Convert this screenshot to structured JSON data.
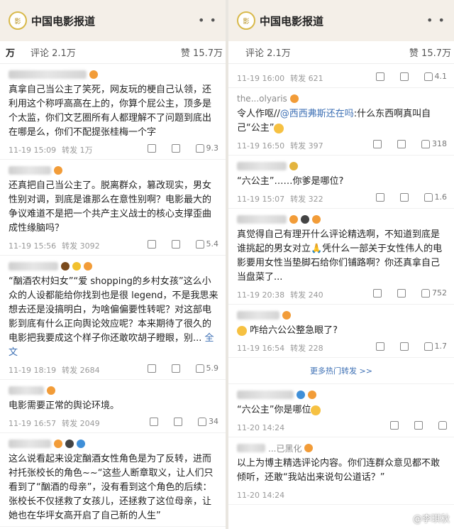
{
  "account": {
    "name": "中国电影报道",
    "more": "• •"
  },
  "left": {
    "stats": {
      "reposts": "万",
      "comments": "评论 2.1万",
      "likes": "赞 15.7万"
    },
    "comments": [
      {
        "user": "",
        "text": "真拿自己当公主了笑死，网友玩的梗自己认领，还利用这个称呼高高在上的，你算个屁公主，顶多是个太监，你们文艺圈所有人都理解不了问题到底出在哪是么，你们不配提张桂梅一个字",
        "time": "11-19 15:09",
        "repost": "转发 1万",
        "likes": "9.3"
      },
      {
        "user": "",
        "text": "还真把自己当公主了。脱离群众，篡改现实，男女性别对调，到底是谁那么在意性别啊？电影最大的争议难道不是把一个共产主义战士的核心支撑歪曲成性缘脑吗？",
        "time": "11-19 15:56",
        "repost": "转发 3092",
        "likes": "5.4"
      },
      {
        "user": "",
        "text": "“酗酒农村妇女”“爱 shopping的乡村女孩”这么小众的人设都能给你找到也是很 legend，不是我思来想去还是没搞明白，为啥偏偏要性转呢？对这部电影到底有什么正向舆论效应呢？本来期待了很久的电影把我要成这个样子你还敢吹胡子瞪眼，别...",
        "more": "全文",
        "time": "11-19 18:19",
        "repost": "转发 2684",
        "likes": "5.9"
      },
      {
        "user": "",
        "text": "电影需要正常的舆论环境。",
        "time": "11-19 16:57",
        "repost": "转发 2049",
        "likes": "34"
      },
      {
        "user": "",
        "text": "这么说看起来设定酗酒女性角色是为了反转，进而衬托张校长的角色~~“这些人断章取义，让人们只看到了“酗酒的母亲”，没有看到这个角色的后续：张校长不仅拯救了女孩儿，还拯救了这位母亲，让她也在华坪女高开启了自己新的人生”",
        "time": "",
        "repost": "",
        "likes": ""
      }
    ]
  },
  "right": {
    "stats": {
      "comments": "评论 2.1万",
      "likes": "赞 15.7万"
    },
    "comments": [
      {
        "user": "",
        "text": "",
        "time": "11-19 16:00",
        "repost": "转发 621",
        "likes": "4.1"
      },
      {
        "user": "the...olyaris",
        "text_pre": "令人作呕//",
        "mention": "@西西弗斯还在吗",
        "text_post": ":什么东西啊真叫自己“公主”",
        "time": "11-19 16:50",
        "repost": "转发 397",
        "likes": "318"
      },
      {
        "user": "",
        "text": "“六公主”……你爹是哪位?",
        "time": "11-19 15:07",
        "repost": "转发 322",
        "likes": "1.6"
      },
      {
        "user": "",
        "text": "真觉得自己有理开什么评论精选啊，不知道到底是谁挑起的男女对立🙏凭什么一部关于女性伟人的电影要用女性当垫脚石给你们铺路啊？你还真拿自己当盘菜了...",
        "time": "11-19 20:38",
        "repost": "转发 240",
        "likes": "752"
      },
      {
        "user": "",
        "text": "咋给六公公整急眼了?",
        "time": "11-19 16:54",
        "repost": "转发 228",
        "likes": "1.7"
      }
    ],
    "more_reposts": "更多热门转发 >>",
    "comments2": [
      {
        "user": "",
        "text": "“六公主”你是哪位",
        "time": "11-20 14:24",
        "repost": "",
        "likes": ""
      },
      {
        "user": "...已黑化",
        "text": "以上为博主精选评论内容。你们连群众意见都不敢倾听，还敢“我站出来说句公道话？”",
        "time": "11-20 14:24",
        "repost": "",
        "likes": ""
      }
    ],
    "watermark": "@李琪秋"
  },
  "colors": {
    "topbar": "#f4efe8",
    "link": "#3c6fb4"
  }
}
